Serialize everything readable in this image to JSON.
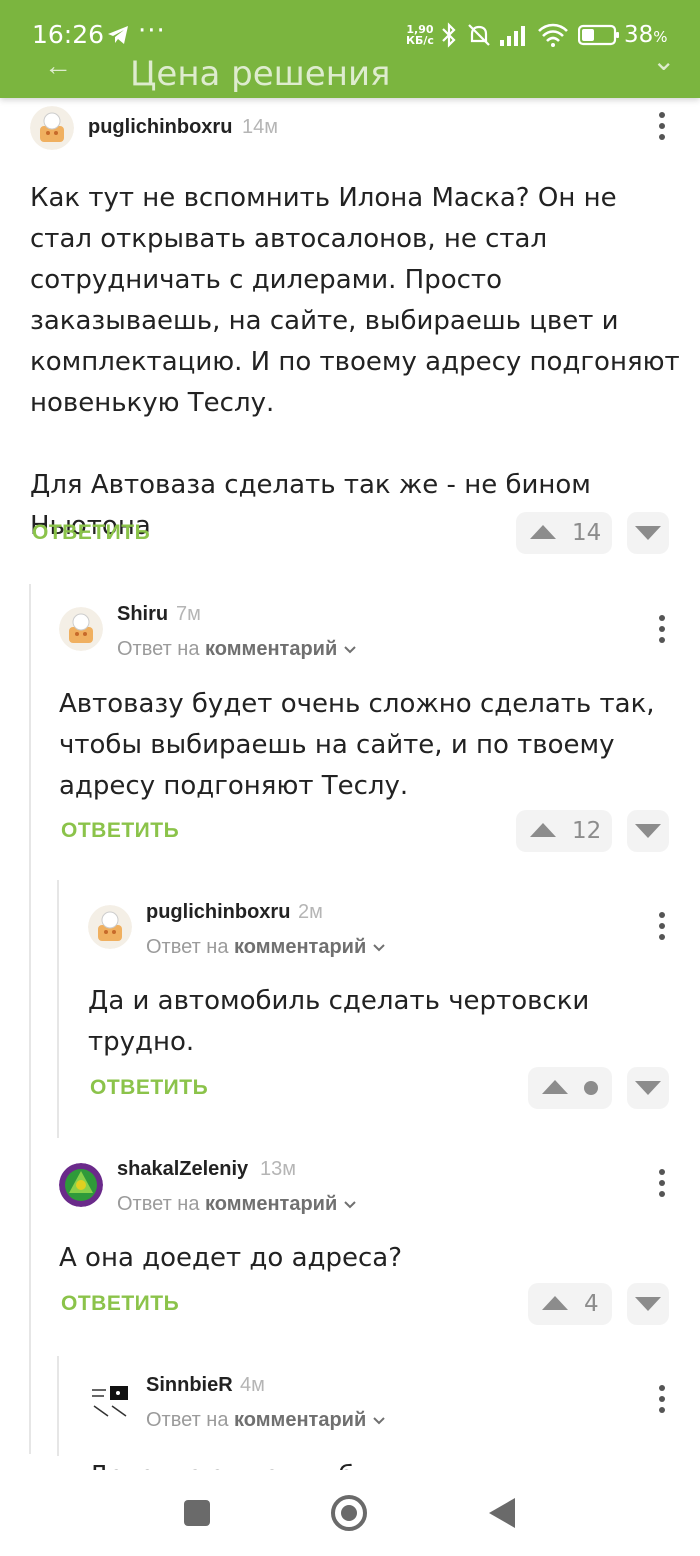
{
  "status_bar": {
    "time": "16:26",
    "more": "···",
    "net_speed_value": "1,90",
    "net_speed_unit": "КБ/с",
    "battery": "38",
    "battery_unit": "%",
    "hidden_title": "Цена решения"
  },
  "comments": [
    {
      "username": "puglichinboxru",
      "time": "14м",
      "reply_to": null,
      "text": [
        "Как тут не вспомнить Илона Маска? Он не стал открывать автосалонов, не стал сотрудничать с дилерами. Просто заказываешь, на сайте, выбираешь цвет и комплектацию. И по твоему адресу подгоняют новенькую Теслу.",
        "",
        "Для Автоваза сделать так же - не бином Ньютона"
      ],
      "reply_label": "ОТВЕТИТЬ",
      "rating": "14"
    },
    {
      "username": "Shiru",
      "time": "7м",
      "reply_prefix": "Ответ на",
      "reply_target": "комментарий",
      "text": [
        "Автовазу будет очень сложно сделать так, чтобы выбираешь на сайте, и по твоему адресу подгоняют Теслу."
      ],
      "reply_label": "ОТВЕТИТЬ",
      "rating": "12"
    },
    {
      "username": "puglichinboxru",
      "time": "2м",
      "reply_prefix": "Ответ на",
      "reply_target": "комментарий",
      "text": [
        "Да и автомобиль сделать чертовски трудно."
      ],
      "reply_label": "ОТВЕТИТЬ",
      "rating": ""
    },
    {
      "username": "shakalZeleniy",
      "time": "13м",
      "reply_prefix": "Ответ на",
      "reply_target": "комментарий",
      "text": [
        "А она доедет до адреса?"
      ],
      "reply_label": "ОТВЕТИТЬ",
      "rating": "4"
    },
    {
      "username": "SinnbieR",
      "time": "4м",
      "reply_prefix": "Ответ на",
      "reply_target": "комментарий",
      "text": [
        "Дотолкают как нибудь"
      ]
    }
  ],
  "colors": {
    "accent": "#7bb53f",
    "reply": "#8bc34a",
    "vote_bg": "#f3f3f3",
    "vote_icon": "#8c8c8c"
  }
}
